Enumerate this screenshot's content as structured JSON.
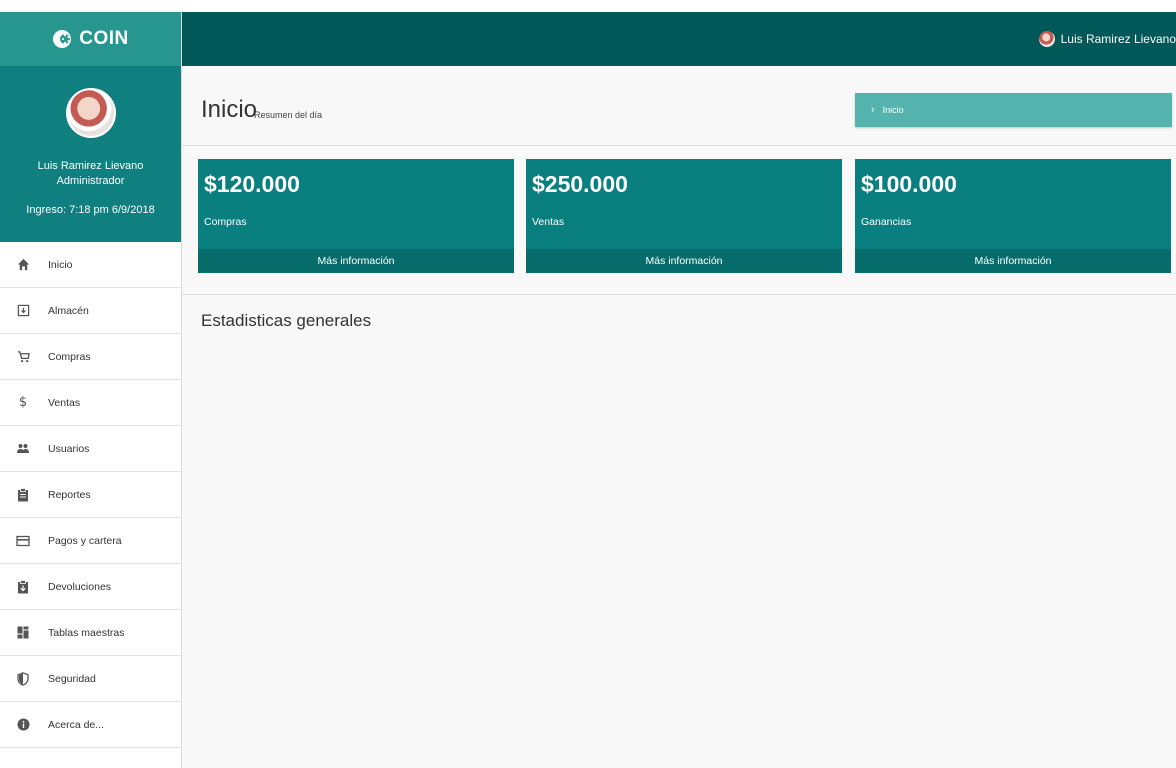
{
  "brand": {
    "name": "COIN"
  },
  "header": {
    "user_name": "Luis Ramirez Lievano"
  },
  "profile": {
    "name": "Luis Ramirez Lievano",
    "role": "Administrador",
    "login": "Ingreso: 7:18 pm 6/9/2018"
  },
  "sidebar": {
    "items": [
      {
        "label": "Inicio",
        "icon": "home-icon"
      },
      {
        "label": "Almacén",
        "icon": "warehouse-icon"
      },
      {
        "label": "Compras",
        "icon": "cart-icon"
      },
      {
        "label": "Ventas",
        "icon": "dollar-icon"
      },
      {
        "label": "Usuarios",
        "icon": "users-icon"
      },
      {
        "label": "Reportes",
        "icon": "clipboard-icon"
      },
      {
        "label": "Pagos y cartera",
        "icon": "card-icon"
      },
      {
        "label": "Devoluciones",
        "icon": "return-icon"
      },
      {
        "label": "Tablas maestras",
        "icon": "grid-icon"
      },
      {
        "label": "Seguridad",
        "icon": "shield-icon"
      },
      {
        "label": "Acerca de...",
        "icon": "info-icon"
      }
    ]
  },
  "page": {
    "title": "Inicio",
    "subtitle": "Resumen del día",
    "breadcrumb": "Inicio",
    "stats_title": "Estadisticas generales"
  },
  "cards": [
    {
      "amount": "$120.000",
      "label": "Compras",
      "more": "Más información"
    },
    {
      "amount": "$250.000",
      "label": "Ventas",
      "more": "Más información"
    },
    {
      "amount": "$100.000",
      "label": "Ganancias",
      "more": "Más información"
    }
  ],
  "colors": {
    "brand_bar": "#26968f",
    "header": "#005858",
    "card": "#0a7f7f",
    "breadcrumb": "#54b3ad"
  }
}
